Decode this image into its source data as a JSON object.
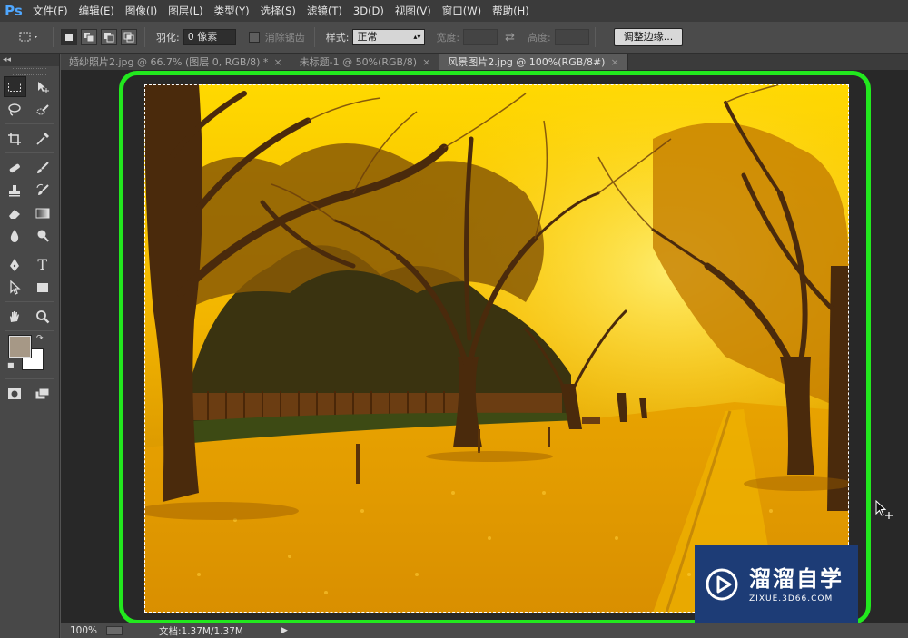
{
  "app": {
    "logo": "Ps"
  },
  "menu": [
    "文件(F)",
    "编辑(E)",
    "图像(I)",
    "图层(L)",
    "类型(Y)",
    "选择(S)",
    "滤镜(T)",
    "3D(D)",
    "视图(V)",
    "窗口(W)",
    "帮助(H)"
  ],
  "options": {
    "feather_label": "羽化:",
    "feather_value": "0 像素",
    "antialias_label": "消除锯齿",
    "style_label": "样式:",
    "style_value": "正常",
    "width_label": "宽度:",
    "height_label": "高度:",
    "refine_button": "调整边缘..."
  },
  "tabs": [
    {
      "label": "婚纱照片2.jpg @ 66.7% (图层 0, RGB/8) *",
      "close": "×",
      "active": false
    },
    {
      "label": "未标题-1 @ 50%(RGB/8)",
      "close": "×",
      "active": false
    },
    {
      "label": "风景图片2.jpg @ 100%(RGB/8#)",
      "close": "×",
      "active": true
    }
  ],
  "toolbox": {
    "collapse": "◂◂"
  },
  "colors": {
    "foreground": "#a69886",
    "background": "#ffffff",
    "highlight": "#22e81e",
    "watermark_bg": "#1d3c76"
  },
  "watermark": {
    "title": "溜溜自学",
    "url": "ZIXUE.3D66.COM"
  },
  "status": {
    "zoom": "100%",
    "doc": "文档:1.37M/1.37M"
  }
}
